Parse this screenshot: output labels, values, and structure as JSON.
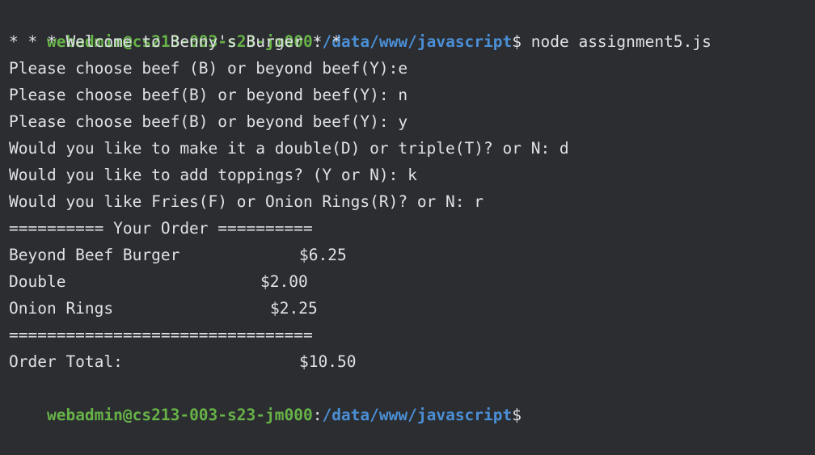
{
  "terminal": {
    "prompt": {
      "user_host": "webadmin@cs213-003-s23-jm000",
      "sep": ":",
      "path": "/data/www/javascript",
      "dollar": "$"
    },
    "command": " node assignment5.js",
    "lines": [
      "* * * Welcome to Benny's Burger * *",
      "Please choose beef (B) or beyond beef(Y):e",
      "Please choose beef(B) or beyond beef(Y): n",
      "Please choose beef(B) or beyond beef(Y): y",
      "Would you like to make it a double(D) or triple(T)? or N: d",
      "Would you like to add toppings? (Y or N): k",
      "Would you like Fries(F) or Onion Rings(R)? or N: r",
      "========== Your Order =========="
    ],
    "order_items": [
      {
        "name": "Beyond Beef Burger",
        "price": "$6.25"
      },
      {
        "name": "Double",
        "price": "$2.00"
      },
      {
        "name": "Onion Rings",
        "price": "$2.25"
      }
    ],
    "separator": "================================",
    "total": {
      "label": "Order Total:",
      "price": "$10.50"
    }
  },
  "colors": {
    "background": "#2b2d30",
    "text": "#dfe1e5",
    "user_host": "#67b348",
    "path": "#4b8fd6"
  }
}
